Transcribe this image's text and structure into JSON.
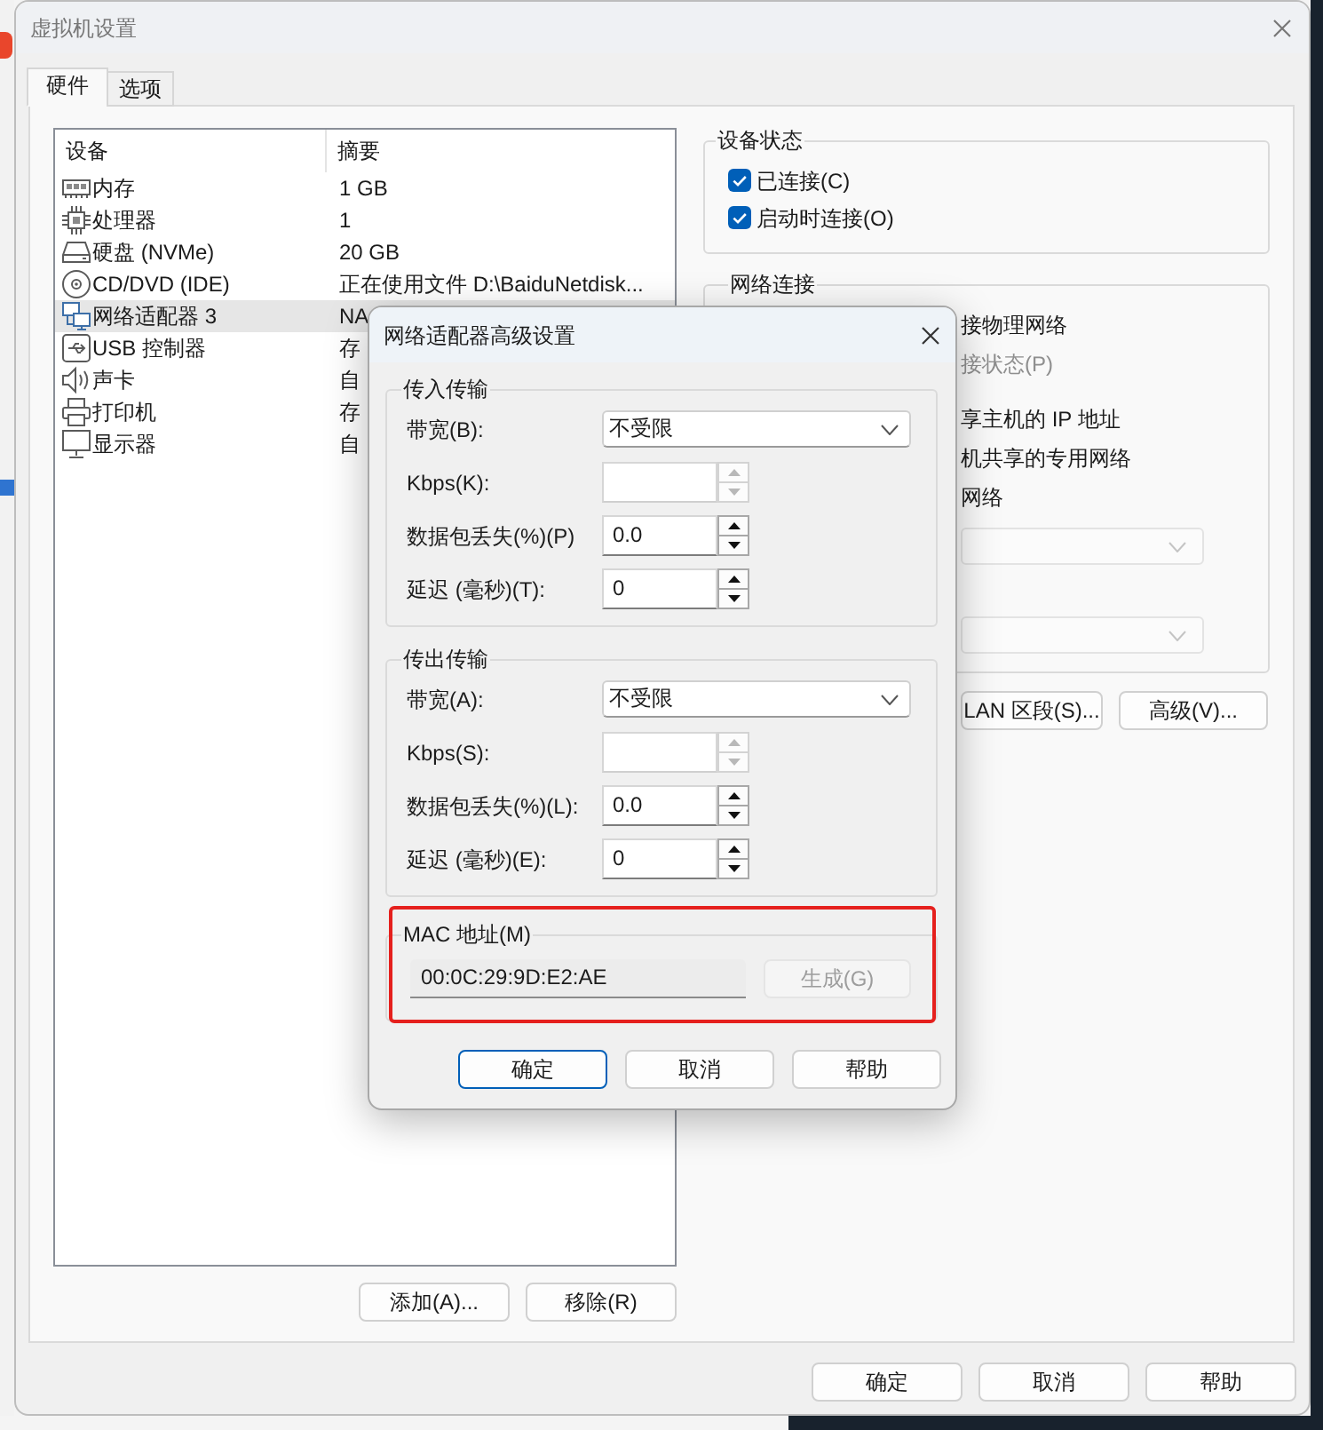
{
  "window": {
    "title": "虚拟机设置"
  },
  "tabs": [
    {
      "label": "硬件",
      "selected": true
    },
    {
      "label": "选项",
      "selected": false
    }
  ],
  "devices": {
    "columns": [
      "设备",
      "摘要"
    ],
    "rows": [
      {
        "kind": "memory",
        "name": "内存",
        "summary": "1 GB",
        "selected": false
      },
      {
        "kind": "processor",
        "name": "处理器",
        "summary": "1",
        "selected": false
      },
      {
        "kind": "disk",
        "name": "硬盘 (NVMe)",
        "summary": "20 GB",
        "selected": false
      },
      {
        "kind": "cdrom",
        "name": "CD/DVD (IDE)",
        "summary": "正在使用文件 D:\\BaiduNetdisk...",
        "selected": false
      },
      {
        "kind": "network",
        "name": "网络适配器 3",
        "summary": "NA",
        "selected": true
      },
      {
        "kind": "usb",
        "name": "USB 控制器",
        "summary": "存",
        "selected": false
      },
      {
        "kind": "sound",
        "name": "声卡",
        "summary": "自",
        "selected": false
      },
      {
        "kind": "printer",
        "name": "打印机",
        "summary": "存",
        "selected": false
      },
      {
        "kind": "display",
        "name": "显示器",
        "summary": "自",
        "selected": false
      }
    ]
  },
  "device_buttons": [
    {
      "label": "添加(A)..."
    },
    {
      "label": "移除(R)"
    }
  ],
  "device_status": {
    "title": "设备状态",
    "options": [
      {
        "label": "已连接(C)",
        "checked": true
      },
      {
        "label": "启动时连接(O)",
        "checked": true
      }
    ]
  },
  "network_connection": {
    "title": "网络连接",
    "options": [
      {
        "kind": "option",
        "label": "接物理网络",
        "disabled": false
      },
      {
        "kind": "sub_option",
        "label": "接状态(P)",
        "disabled": true
      },
      {
        "kind": "option",
        "label": "享主机的 IP 地址",
        "disabled": false
      },
      {
        "kind": "option",
        "label": "机共享的专用网络",
        "disabled": false
      },
      {
        "kind": "option",
        "label": "网络",
        "disabled": false
      }
    ],
    "dropdowns": [
      {
        "disabled": true
      },
      {
        "disabled": true
      }
    ],
    "buttons": [
      {
        "label": "LAN 区段(S)..."
      },
      {
        "label": "高级(V)..."
      }
    ]
  },
  "buttons": [
    {
      "label": "确定"
    },
    {
      "label": "取消"
    },
    {
      "label": "帮助"
    }
  ],
  "dialog": {
    "title": "网络适配器高级设置",
    "groups": [
      {
        "title": "传入传输",
        "fields": [
          {
            "kind": "dropdown",
            "label": "带宽(B):",
            "value": "不受限"
          },
          {
            "kind": "spinner",
            "label": "Kbps(K):",
            "disabled": true
          },
          {
            "kind": "spinner",
            "label": "数据包丢失(%)(P)",
            "value": "0.0",
            "disabled": false
          },
          {
            "kind": "spinner",
            "label": "延迟 (毫秒)(T):",
            "value": "0",
            "disabled": false
          }
        ]
      },
      {
        "title": "传出传输",
        "fields": [
          {
            "kind": "dropdown",
            "label": "带宽(A):",
            "value": "不受限"
          },
          {
            "kind": "spinner",
            "label": "Kbps(S):",
            "disabled": true
          },
          {
            "kind": "spinner",
            "label": "数据包丢失(%)(L):",
            "value": "0.0",
            "disabled": false
          },
          {
            "kind": "spinner",
            "label": "延迟 (毫秒)(E):",
            "value": "0",
            "disabled": false
          }
        ]
      }
    ],
    "mac": {
      "title": "MAC 地址(M)",
      "value": "00:0C:29:9D:E2:AE",
      "highlighted": true,
      "button": {
        "label": "生成(G)",
        "disabled": true
      }
    },
    "buttons": [
      {
        "label": "确定",
        "default": true
      },
      {
        "label": "取消",
        "default": false
      },
      {
        "label": "帮助",
        "default": false
      }
    ]
  }
}
